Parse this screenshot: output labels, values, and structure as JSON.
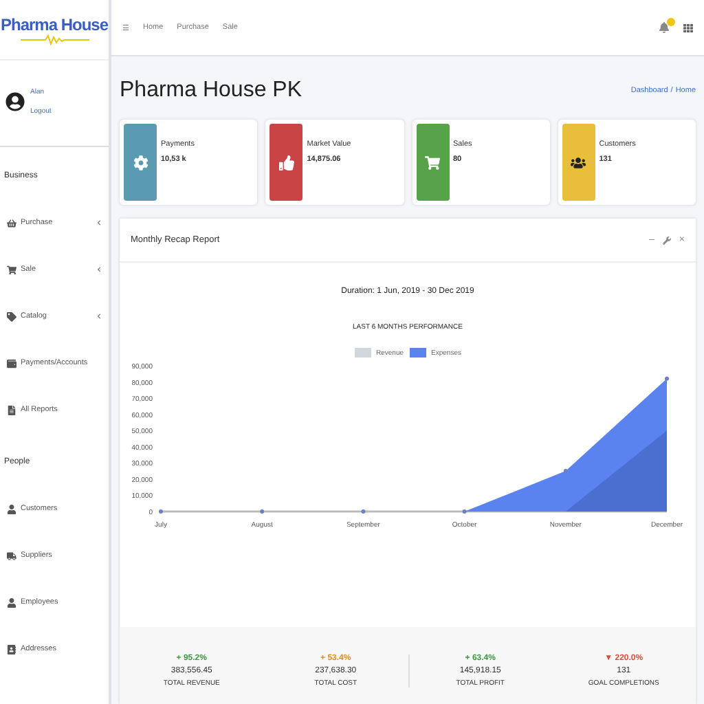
{
  "brand": {
    "name": "Pharma House"
  },
  "user": {
    "name": "Alan",
    "link": "Logout"
  },
  "sidebar": {
    "sections": [
      {
        "title": "Business",
        "items": [
          {
            "label": "Purchase",
            "expandable": true
          },
          {
            "label": "Sale",
            "expandable": true
          },
          {
            "label": "Catalog",
            "expandable": true
          },
          {
            "label": "Payments/Accounts",
            "expandable": false
          },
          {
            "label": "All Reports",
            "expandable": false
          }
        ]
      },
      {
        "title": "People",
        "items": [
          {
            "label": "Customers",
            "expandable": false
          },
          {
            "label": "Suppliers",
            "expandable": false
          },
          {
            "label": "Employees",
            "expandable": false
          },
          {
            "label": "Addresses",
            "expandable": false
          }
        ]
      }
    ]
  },
  "topbar": {
    "menu": "☰",
    "links": [
      "Home",
      "Purchase",
      "Sale"
    ]
  },
  "page": {
    "title": "Pharma House PK",
    "breadcrumb": {
      "items": [
        "Dashboard",
        "Home"
      ],
      "separator": "/"
    }
  },
  "info_boxes": [
    {
      "label": "Payments",
      "value": "10,53 k",
      "color": "#5a9bb2"
    },
    {
      "label": "Market Value",
      "value": "14,875.06",
      "color": "#c94444"
    },
    {
      "label": "Sales",
      "value": "80",
      "color": "#58a24a"
    },
    {
      "label": "Customers",
      "value": "131",
      "color": "#e8be3a"
    }
  ],
  "report": {
    "title": "Monthly Recap Report",
    "tools": [
      "–",
      "×"
    ],
    "duration": "Duration: 1 Jun, 2019 - 30 Dec 2019",
    "chart_data": {
      "type": "area",
      "title": "LAST 6 MONTHS PERFORMANCE",
      "categories": [
        "July",
        "August",
        "September",
        "October",
        "November",
        "December"
      ],
      "series": [
        {
          "name": "Revenue",
          "color": "#d2d6de",
          "values": [
            0,
            0,
            0,
            0,
            0,
            50000
          ]
        },
        {
          "name": "Expenses",
          "color": "#5b83f0",
          "values": [
            0,
            0,
            0,
            0,
            25000,
            82000
          ]
        }
      ],
      "ylim": [
        0,
        90000
      ],
      "yticks": [
        {
          "value": 0,
          "label": "0"
        },
        {
          "value": 10000,
          "label": "10,000"
        },
        {
          "value": 20000,
          "label": "20,000"
        },
        {
          "value": 30000,
          "label": "30,000"
        },
        {
          "value": 40000,
          "label": "40,000"
        },
        {
          "value": 50000,
          "label": "50,000"
        },
        {
          "value": 60000,
          "label": "60,000"
        },
        {
          "value": 70000,
          "label": "70,000"
        },
        {
          "value": 80000,
          "label": "80,000"
        },
        {
          "value": 90000,
          "label": "90,000"
        }
      ]
    },
    "stats": [
      {
        "change": "+ 95.2%",
        "color": "#3c9a40",
        "value": "383,556.45",
        "label": "TOTAL REVENUE"
      },
      {
        "change": "+ 53.4%",
        "color": "#e08e1b",
        "value": "237,638.30",
        "label": "TOTAL COST"
      },
      {
        "change": "+ 63.4%",
        "color": "#3c9a40",
        "value": "145,918.15",
        "label": "TOTAL PROFIT"
      },
      {
        "change": "▼ 220.0%",
        "color": "#dd4b39",
        "value": "131",
        "label": "GOAL COMPLETIONS"
      }
    ]
  }
}
